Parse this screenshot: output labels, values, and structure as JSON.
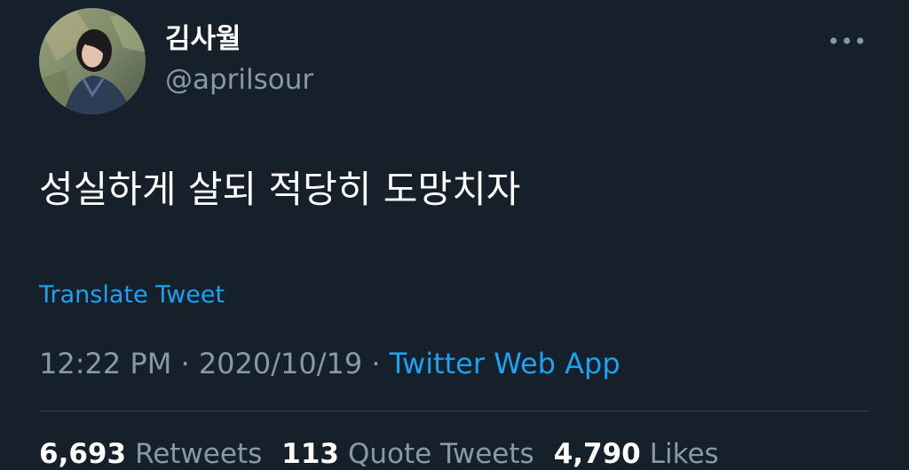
{
  "user": {
    "display_name": "김사월",
    "handle": "@aprilsour",
    "avatar_icon": "profile-photo"
  },
  "more_icon": "more-horizontal-icon",
  "tweet": {
    "text": "성실하게 살되 적당히 도망치자",
    "translate_label": "Translate Tweet",
    "time": "12:22 PM",
    "separator": "·",
    "date": "2020/10/19",
    "source": "Twitter Web App"
  },
  "stats": {
    "retweets_count": "6,693",
    "retweets_label": "Retweets",
    "quote_count": "113",
    "quote_label": "Quote Tweets",
    "likes_count": "4,790",
    "likes_label": "Likes"
  },
  "colors": {
    "background": "#15202b",
    "text": "#ffffff",
    "secondary": "#8899a6",
    "accent": "#1da1f2",
    "divider": "#38444d"
  }
}
